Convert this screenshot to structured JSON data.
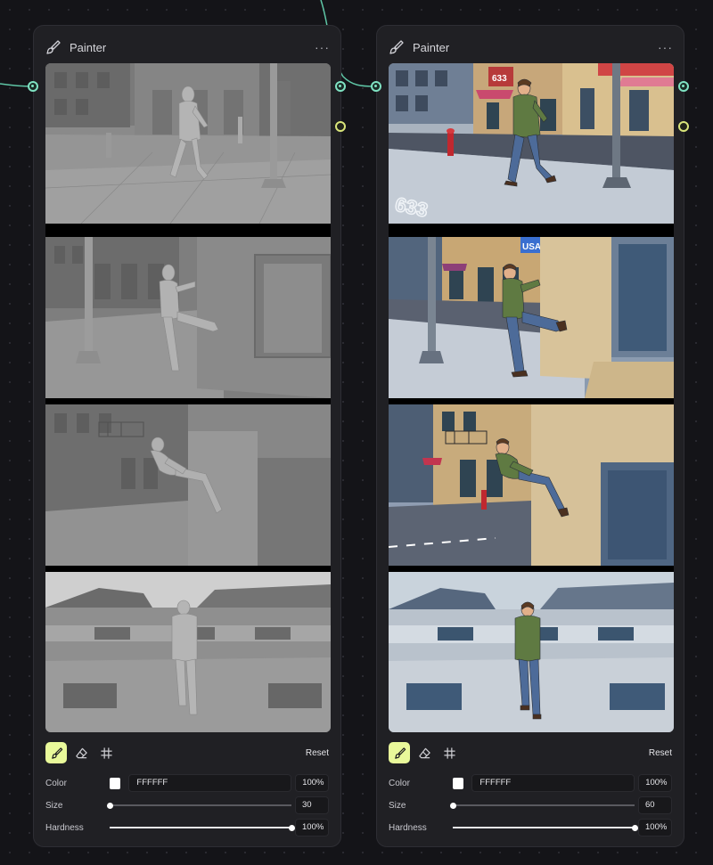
{
  "colors": {
    "accent_teal": "#7fe2c2",
    "accent_yellow": "#d9e57a",
    "active_tool": "#e9f99a",
    "panel_bg": "#202024",
    "canvas_bg": "#141418"
  },
  "panels": [
    {
      "title": "Painter",
      "menu": "···",
      "tools": {
        "brush": "brush-icon",
        "eraser": "eraser-icon",
        "grid": "grid-icon",
        "active": "brush"
      },
      "reset_label": "Reset",
      "color": {
        "label": "Color",
        "hex": "FFFFFF",
        "opacity": "100%",
        "swatch": "#ffffff"
      },
      "size": {
        "label": "Size",
        "value": "30",
        "slider_fraction": 0.0
      },
      "hardness": {
        "label": "Hardness",
        "value": "100%",
        "slider_fraction": 1.0
      },
      "frames": [
        "gray 3D mannequin walking on city sidewalk",
        "mannequin kicking off building wall",
        "mannequin leaping from wall",
        "mannequin walking on rooftop"
      ]
    },
    {
      "title": "Painter",
      "menu": "···",
      "tools": {
        "brush": "brush-icon",
        "eraser": "eraser-icon",
        "grid": "grid-icon",
        "active": "brush"
      },
      "reset_label": "Reset",
      "color": {
        "label": "Color",
        "hex": "FFFFFF",
        "opacity": "100%",
        "swatch": "#ffffff"
      },
      "size": {
        "label": "Size",
        "value": "60",
        "slider_fraction": 0.0
      },
      "hardness": {
        "label": "Hardness",
        "value": "100%",
        "slider_fraction": 1.0
      },
      "frames": [
        "illustrated man in green jacket walking on street",
        "man kicking off building wall",
        "man leaping from wall",
        "man walking on rooftop"
      ],
      "signs": {
        "sign_633": "633",
        "street_number": "633",
        "sign_usa": "USA"
      }
    }
  ]
}
